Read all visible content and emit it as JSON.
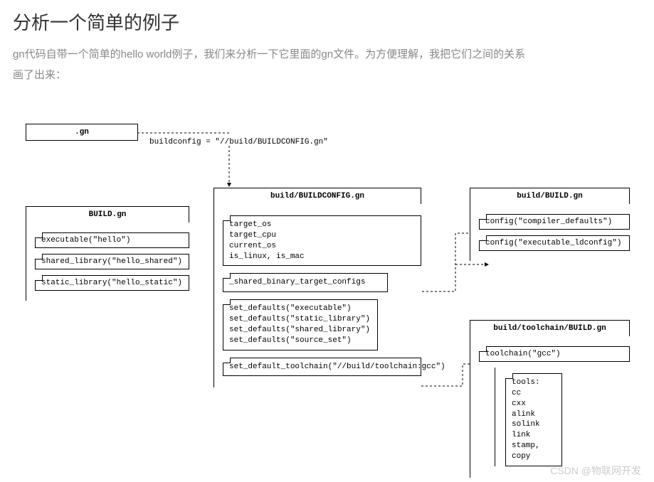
{
  "title": "分析一个简单的例子",
  "paragraph": "gn代码自带一个简单的hello world例子，我们来分析一下它里面的gn文件。为方便理解，我把它们之间的关系画了出来：",
  "gn_box": ".gn",
  "buildconfig_label": "buildconfig = \"//build/BUILDCONFIG.gn\"",
  "build_gn": {
    "title": "BUILD.gn",
    "items": [
      "executable(\"hello\")",
      "shared_library(\"hello_shared\")",
      "static_library(\"hello_static\")"
    ]
  },
  "buildconfig_gn": {
    "title": "build/BUILDCONFIG.gn",
    "vars": "target_os\ntarget_cpu\ncurrent_os\nis_linux, is_mac",
    "shared": "_shared_binary_target_configs",
    "defaults": "set_defaults(\"executable\")\nset_defaults(\"static_library\")\nset_defaults(\"shared_library\")\nset_defaults(\"source_set\")",
    "toolchain": "set_default_toolchain(\"//build/toolchain:gcc\")"
  },
  "build_build_gn": {
    "title": "build/BUILD.gn",
    "items": [
      "config(\"compiler_defaults\")",
      "config(\"executable_ldconfig\")"
    ]
  },
  "toolchain_gn": {
    "title": "build/toolchain/BUILD.gn",
    "item": "toolchain(\"gcc\")",
    "tools": "tools:\ncc\ncxx\nalink\nsolink\nlink\nstamp,\ncopy"
  },
  "watermark": "CSDN @物联网开发"
}
